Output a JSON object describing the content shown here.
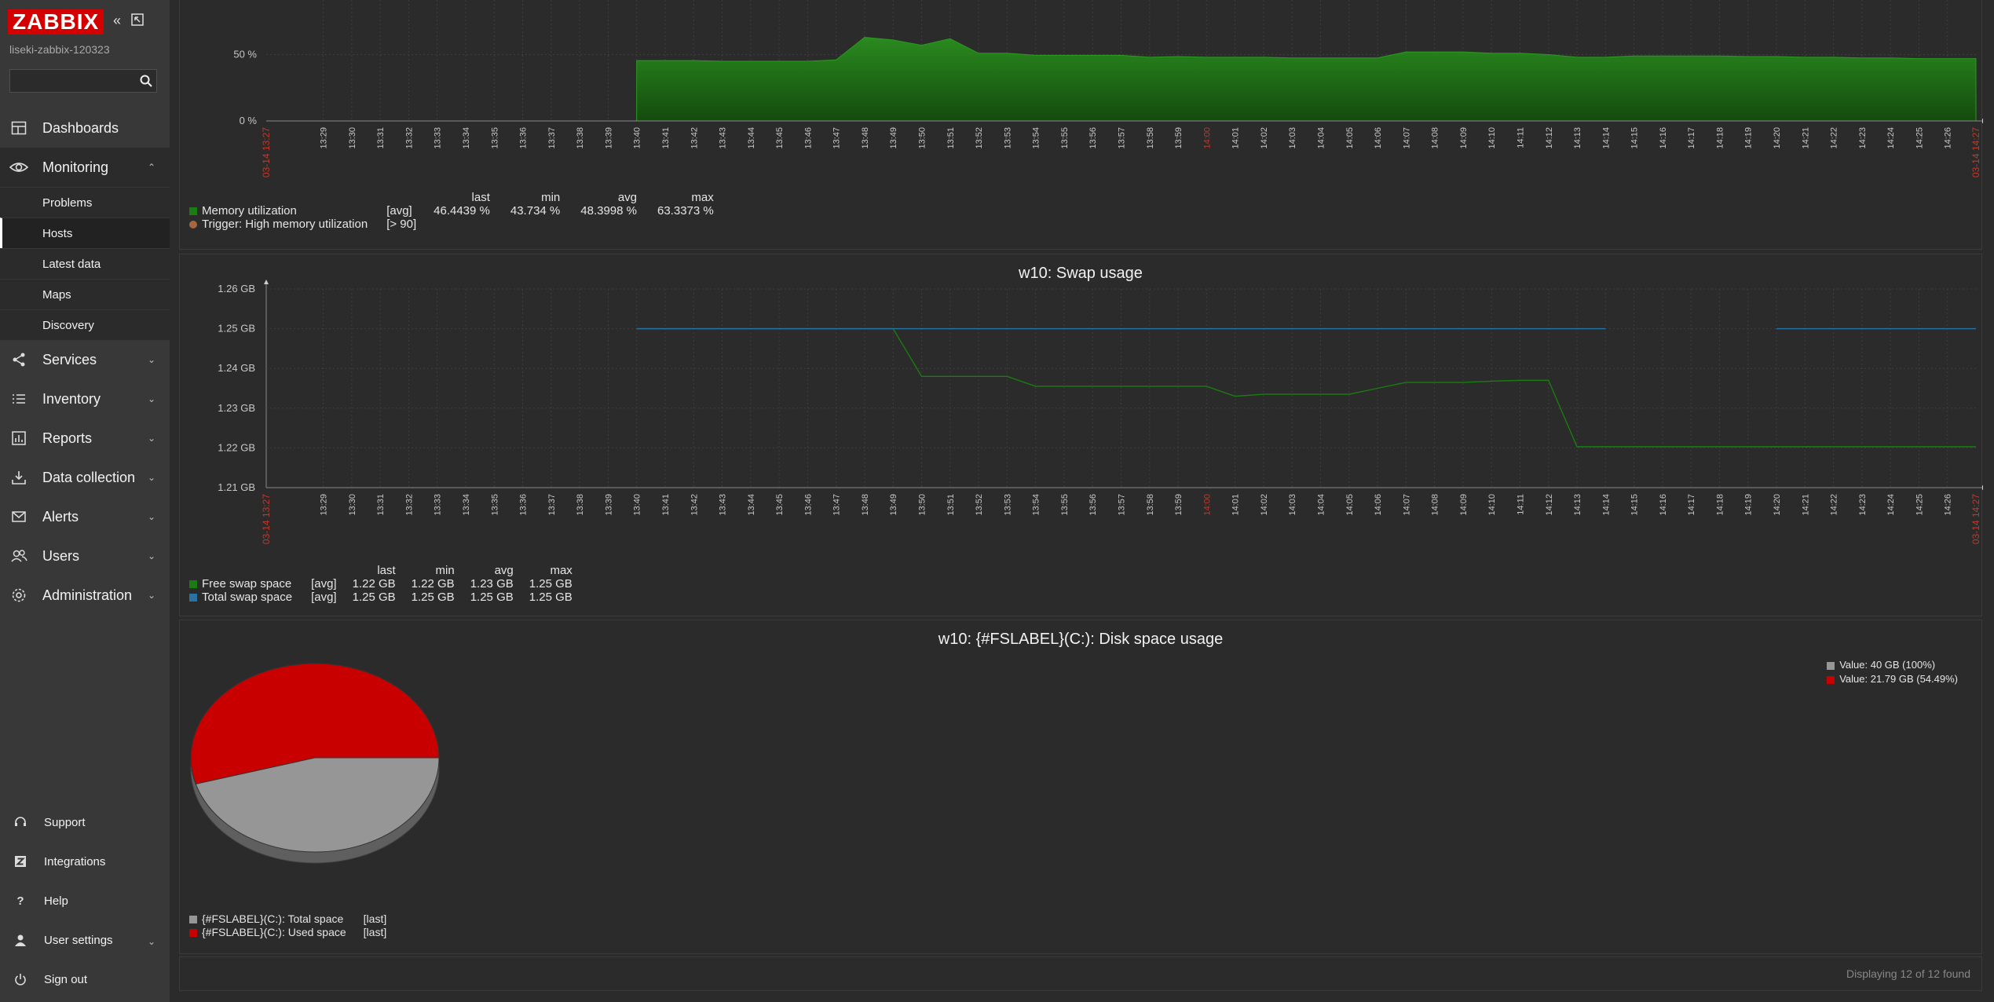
{
  "app": {
    "logo_text": "ZABBIX",
    "hostname": "liseki-zabbix-120323",
    "search_placeholder": ""
  },
  "nav": {
    "dashboards": "Dashboards",
    "monitoring": "Monitoring",
    "monitoring_sub": [
      "Problems",
      "Hosts",
      "Latest data",
      "Maps",
      "Discovery"
    ],
    "services": "Services",
    "inventory": "Inventory",
    "reports": "Reports",
    "data_collection": "Data collection",
    "alerts": "Alerts",
    "users": "Users",
    "administration": "Administration",
    "support": "Support",
    "integrations": "Integrations",
    "help": "Help",
    "user_settings": "User settings",
    "sign_out": "Sign out"
  },
  "icons": {
    "dashboards": "dashboard-grid-icon",
    "monitoring": "eye-icon",
    "services": "services-icon",
    "inventory": "list-icon",
    "reports": "chart-icon",
    "data_collection": "download-icon",
    "alerts": "envelope-icon",
    "users": "users-icon",
    "administration": "gear-icon",
    "support": "headset-icon",
    "integrations": "z-icon",
    "help": "question-icon",
    "user_settings": "user-icon",
    "sign_out": "power-icon"
  },
  "colors": {
    "brand": "#d40000",
    "memory_series": "#1a7c11",
    "trigger": "#a5673f",
    "free_swap": "#1a7c11",
    "total_swap": "#2774a4",
    "disk_total": "#969696",
    "disk_used": "#c80000",
    "date_label": "#c0392b"
  },
  "time_axis": {
    "start_label": "03-14 13:27",
    "end_label": "03-14 14:27",
    "ticks": [
      "13:29",
      "13:30",
      "13:31",
      "13:32",
      "13:33",
      "13:34",
      "13:35",
      "13:36",
      "13:37",
      "13:38",
      "13:39",
      "13:40",
      "13:41",
      "13:42",
      "13:43",
      "13:44",
      "13:45",
      "13:46",
      "13:47",
      "13:48",
      "13:49",
      "13:50",
      "13:51",
      "13:52",
      "13:53",
      "13:54",
      "13:55",
      "13:56",
      "13:57",
      "13:58",
      "13:59",
      "14:00",
      "14:01",
      "14:02",
      "14:03",
      "14:04",
      "14:05",
      "14:06",
      "14:07",
      "14:08",
      "14:09",
      "14:10",
      "14:11",
      "14:12",
      "14:13",
      "14:14",
      "14:15",
      "14:16",
      "14:17",
      "14:18",
      "14:19",
      "14:20",
      "14:21",
      "14:22",
      "14:23",
      "14:24",
      "14:25",
      "14:26"
    ],
    "highlight_tick": "14:00"
  },
  "memory_panel": {
    "y_labels": [
      "50 %",
      "0 %"
    ],
    "legend_headers": [
      "last",
      "min",
      "avg",
      "max"
    ],
    "series": [
      {
        "name": "Memory utilization",
        "func": "[avg]",
        "last": "46.4439 %",
        "min": "43.734 %",
        "avg": "48.3998 %",
        "max": "63.3373 %"
      }
    ],
    "trigger": {
      "label": "Trigger: High memory utilization",
      "threshold": "[> 90]"
    }
  },
  "swap_panel": {
    "title": "w10: Swap usage",
    "y_labels": [
      "1.26 GB",
      "1.25 GB",
      "1.24 GB",
      "1.23 GB",
      "1.22 GB",
      "1.21 GB"
    ],
    "legend_headers": [
      "last",
      "min",
      "avg",
      "max"
    ],
    "series": [
      {
        "name": "Free swap space",
        "func": "[avg]",
        "last": "1.22 GB",
        "min": "1.22 GB",
        "avg": "1.23 GB",
        "max": "1.25 GB"
      },
      {
        "name": "Total swap space",
        "func": "[avg]",
        "last": "1.25 GB",
        "min": "1.25 GB",
        "avg": "1.25 GB",
        "max": "1.25 GB"
      }
    ]
  },
  "disk_panel": {
    "title": "w10: {#FSLABEL}(C:): Disk space usage",
    "pie_legend": [
      "Value: 40 GB (100%)",
      "Value: 21.79 GB (54.49%)"
    ],
    "legend": [
      {
        "name": "{#FSLABEL}(C:): Total space",
        "func": "[last]"
      },
      {
        "name": "{#FSLABEL}(C:): Used space",
        "func": "[last]"
      }
    ]
  },
  "footer": {
    "text": "Displaying 12 of 12 found"
  },
  "chart_data": [
    {
      "type": "area",
      "title": "",
      "ylabel": "",
      "ylim": [
        0,
        100
      ],
      "x": [
        "13:40",
        "13:41",
        "13:42",
        "13:43",
        "13:44",
        "13:45",
        "13:46",
        "13:47",
        "13:48",
        "13:49",
        "13:50",
        "13:51",
        "13:52",
        "13:53",
        "13:54",
        "13:55",
        "13:56",
        "13:57",
        "13:58",
        "13:59",
        "14:00",
        "14:01",
        "14:02",
        "14:03",
        "14:04",
        "14:05",
        "14:06",
        "14:07",
        "14:08",
        "14:09",
        "14:10",
        "14:11",
        "14:12",
        "14:13",
        "14:14",
        "14:15",
        "14:16",
        "14:17",
        "14:18",
        "14:19",
        "14:20",
        "14:21",
        "14:22",
        "14:23",
        "14:24",
        "14:25",
        "14:26",
        "14:27"
      ],
      "series": [
        {
          "name": "Memory utilization",
          "values": [
            45.5,
            45.5,
            45.5,
            45,
            45,
            45,
            45,
            46,
            63,
            61,
            57,
            62,
            51,
            51,
            49.5,
            49.5,
            49.5,
            49.5,
            48,
            48.5,
            48,
            48,
            48,
            47.5,
            47.5,
            47.5,
            47.5,
            52,
            52,
            52,
            51,
            51,
            50,
            48,
            48,
            49,
            49,
            49,
            49,
            48.5,
            48.5,
            48,
            48,
            47.5,
            47.5,
            47,
            47,
            47
          ]
        }
      ]
    },
    {
      "type": "line",
      "title": "w10: Swap usage",
      "ylabel": "",
      "ylim": [
        1.21,
        1.26
      ],
      "x": [
        "13:40",
        "13:41",
        "13:42",
        "13:43",
        "13:44",
        "13:45",
        "13:46",
        "13:47",
        "13:48",
        "13:49",
        "13:50",
        "13:51",
        "13:52",
        "13:53",
        "13:54",
        "13:55",
        "13:56",
        "13:57",
        "13:58",
        "13:59",
        "14:00",
        "14:01",
        "14:02",
        "14:03",
        "14:04",
        "14:05",
        "14:06",
        "14:07",
        "14:08",
        "14:09",
        "14:10",
        "14:11",
        "14:12",
        "14:13",
        "14:14",
        "14:15",
        "14:16",
        "14:17",
        "14:18",
        "14:19",
        "14:20",
        "14:21",
        "14:22",
        "14:23",
        "14:24",
        "14:25",
        "14:26",
        "14:27"
      ],
      "series": [
        {
          "name": "Free swap space",
          "values": [
            1.25,
            1.25,
            1.25,
            1.25,
            1.25,
            1.25,
            1.25,
            1.25,
            1.25,
            1.25,
            1.238,
            1.238,
            1.238,
            1.238,
            1.2355,
            1.2355,
            1.2355,
            1.2355,
            1.2355,
            1.2355,
            1.2355,
            1.233,
            1.2335,
            1.2335,
            1.2335,
            1.2335,
            1.235,
            1.2365,
            1.2365,
            1.2365,
            1.2368,
            1.237,
            1.237,
            1.2203,
            1.2203,
            1.2203,
            1.2203,
            1.2203,
            1.2203,
            1.2203,
            1.2203,
            1.2203,
            1.2203,
            1.2203,
            1.2203,
            1.2203,
            1.2203,
            1.2203
          ]
        },
        {
          "name": "Total swap space",
          "values": [
            1.25,
            1.25,
            1.25,
            1.25,
            1.25,
            1.25,
            1.25,
            1.25,
            1.25,
            1.25,
            1.25,
            1.25,
            1.25,
            1.25,
            1.25,
            1.25,
            1.25,
            1.25,
            1.25,
            1.25,
            1.25,
            1.25,
            1.25,
            1.25,
            1.25,
            1.25,
            1.25,
            1.25,
            1.25,
            1.25,
            1.25,
            1.25,
            1.25,
            1.25,
            1.25,
            null,
            null,
            null,
            null,
            null,
            1.25,
            1.25,
            1.25,
            1.25,
            1.25,
            1.25,
            1.25,
            1.25
          ]
        }
      ]
    },
    {
      "type": "pie",
      "title": "w10: {#FSLABEL}(C:): Disk space usage",
      "categories": [
        "{#FSLABEL}(C:): Total space",
        "{#FSLABEL}(C:): Used space"
      ],
      "values": [
        45.51,
        54.49
      ]
    }
  ]
}
